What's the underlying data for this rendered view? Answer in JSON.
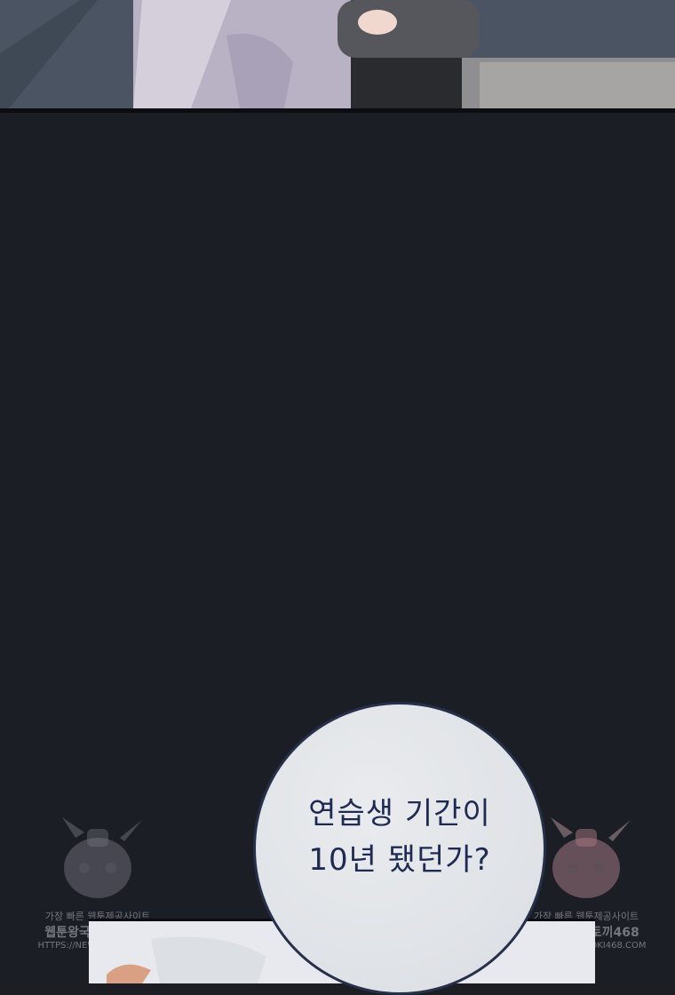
{
  "speech_bubble": {
    "line1": "연습생 기간이",
    "line2": "10년 됐던가?"
  },
  "watermark_left": {
    "line1": "가장 빠른 웹툰제공사이트",
    "line2": "웹툰왕국뉴토끼468",
    "line3": "HTTPS://NEWTOKI468.COM"
  },
  "watermark_right": {
    "line1": "가장 빠른 웹툰제공사이트",
    "line2": "웹툰왕국뉴토끼468",
    "line3": "HTTPS://NEWTOKI468.COM"
  },
  "colors": {
    "background": "#1c1e25",
    "bubble_fill": "#e2e5e9",
    "bubble_text": "#1e2a52"
  }
}
